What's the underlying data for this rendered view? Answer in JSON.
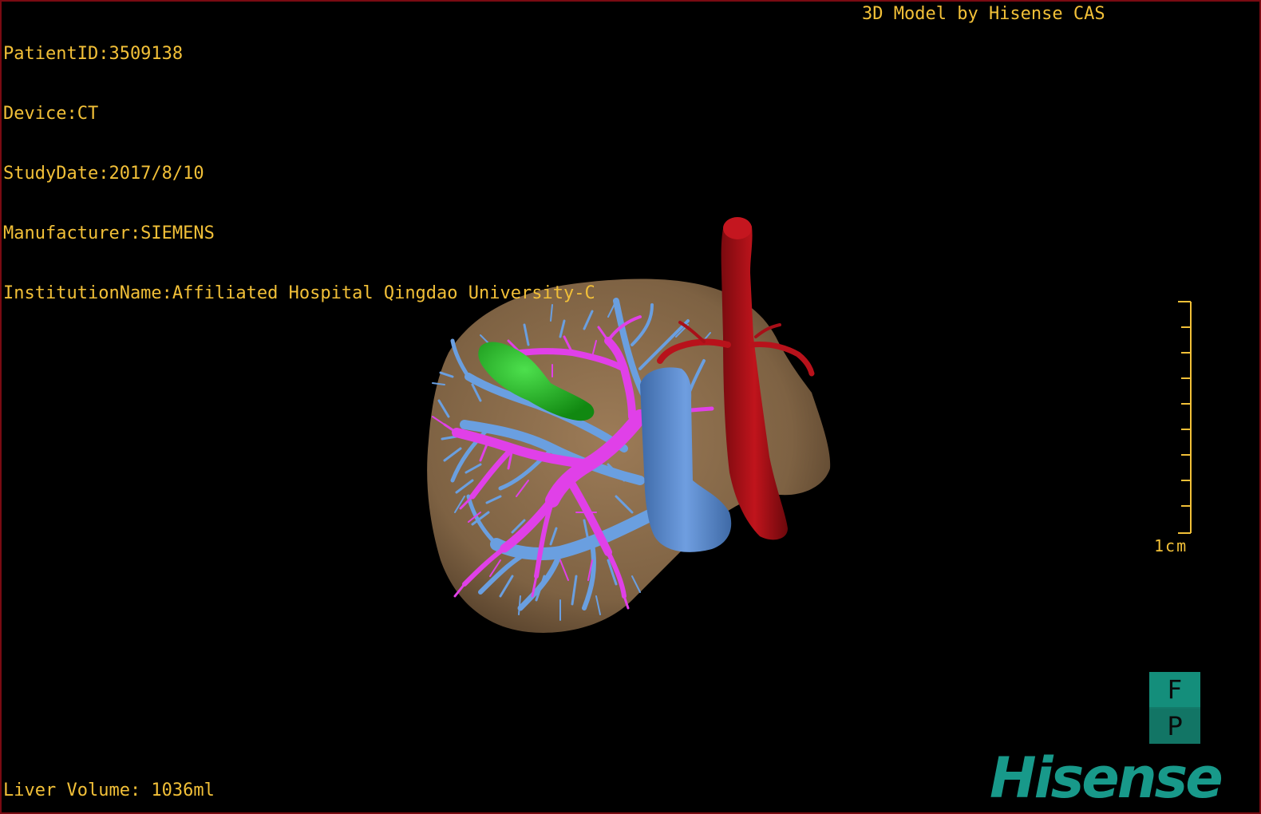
{
  "overlay": {
    "patient_id": "PatientID:3509138",
    "device": "Device:CT",
    "study_date": "StudyDate:2017/8/10",
    "manufacturer": "Manufacturer:SIEMENS",
    "institution": "InstitutionName:Affiliated Hospital Qingdao University-C",
    "credit": "3D Model by Hisense CAS",
    "liver_volume": "Liver Volume: 1036ml"
  },
  "scale": {
    "label": "1cm"
  },
  "orientation": {
    "top": "F",
    "bottom": "P"
  },
  "brand": {
    "logo_text": "Hisense"
  },
  "colors": {
    "hud_text": "#f2c038",
    "liver": "#8a6c4c",
    "gallbladder": "#22b022",
    "portal_vein": "#e040e8",
    "hepatic_veins": "#6a9fe0",
    "ivc": "#5f8fcf",
    "aorta": "#b01018",
    "brand": "#18998a"
  }
}
